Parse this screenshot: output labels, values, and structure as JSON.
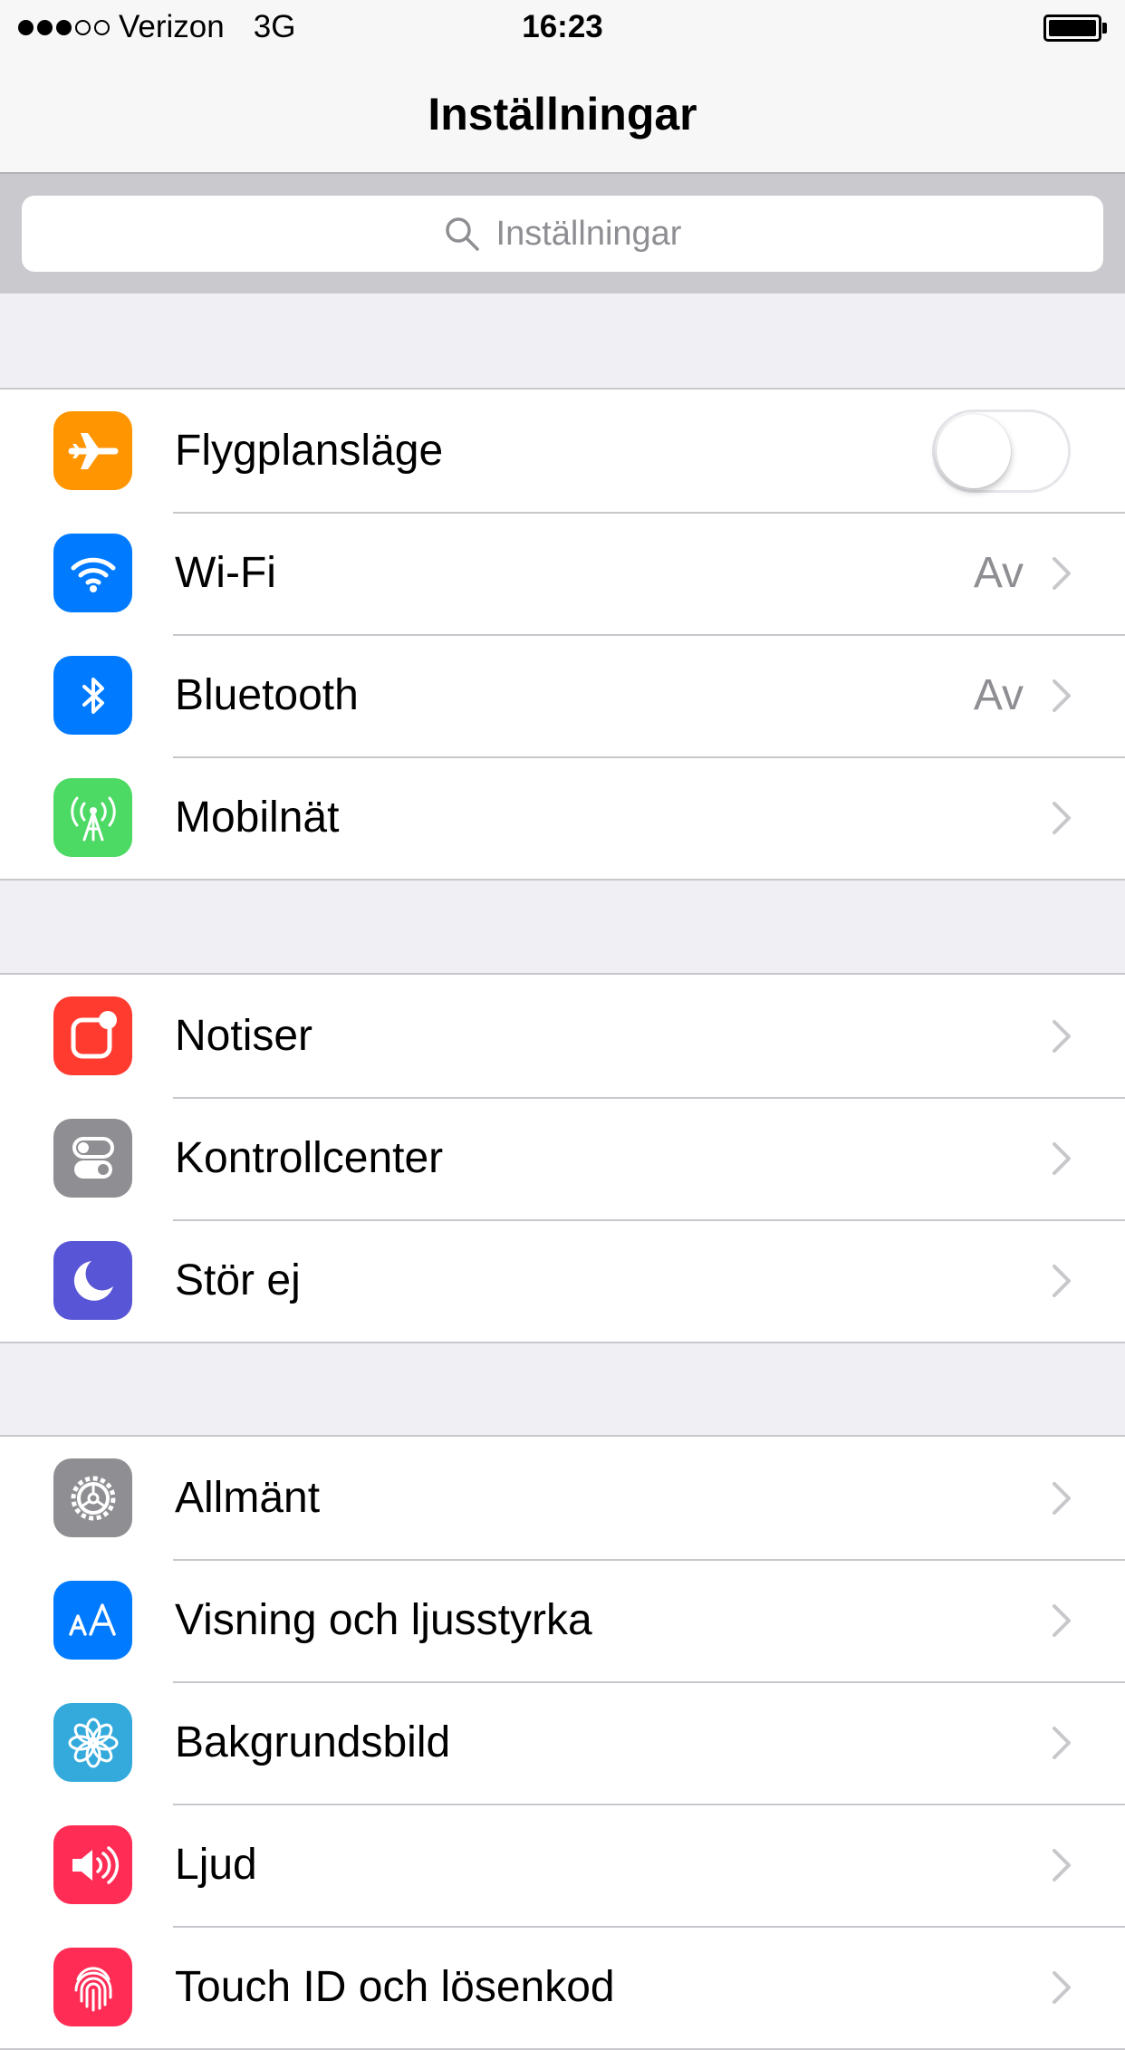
{
  "status_bar": {
    "carrier": "Verizon",
    "network": "3G",
    "time": "16:23",
    "signal_bars_filled": 3,
    "signal_bars_total": 5
  },
  "nav": {
    "title": "Inställningar"
  },
  "search": {
    "placeholder": "Inställningar"
  },
  "colors": {
    "orange": "#ff9500",
    "blue": "#007aff",
    "green": "#4cd964",
    "red": "#ff3b30",
    "gray": "#8e8e93",
    "purple": "#5856d6",
    "teal": "#34aadc",
    "pink": "#ff2d55"
  },
  "groups": [
    {
      "items": [
        {
          "label": "Flygplansläge",
          "icon": "airplane-icon",
          "color": "#ff9500",
          "control": "toggle",
          "toggle_on": false
        },
        {
          "label": "Wi-Fi",
          "icon": "wifi-icon",
          "color": "#007aff",
          "value": "Av"
        },
        {
          "label": "Bluetooth",
          "icon": "bluetooth-icon",
          "color": "#007aff",
          "value": "Av"
        },
        {
          "label": "Mobilnät",
          "icon": "cellular-antenna-icon",
          "color": "#4cd964"
        }
      ]
    },
    {
      "items": [
        {
          "label": "Notiser",
          "icon": "notifications-icon",
          "color": "#ff3b30"
        },
        {
          "label": "Kontrollcenter",
          "icon": "control-center-icon",
          "color": "#8e8e93"
        },
        {
          "label": "Stör ej",
          "icon": "moon-icon",
          "color": "#5856d6"
        }
      ]
    },
    {
      "items": [
        {
          "label": "Allmänt",
          "icon": "gear-icon",
          "color": "#8e8e93"
        },
        {
          "label": "Visning och ljusstyrka",
          "icon": "text-size-icon",
          "color": "#007aff"
        },
        {
          "label": "Bakgrundsbild",
          "icon": "flower-icon",
          "color": "#34aadc"
        },
        {
          "label": "Ljud",
          "icon": "speaker-icon",
          "color": "#ff2d55"
        },
        {
          "label": "Touch ID och lösenkod",
          "icon": "fingerprint-icon",
          "color": "#ff2d55"
        }
      ]
    }
  ]
}
